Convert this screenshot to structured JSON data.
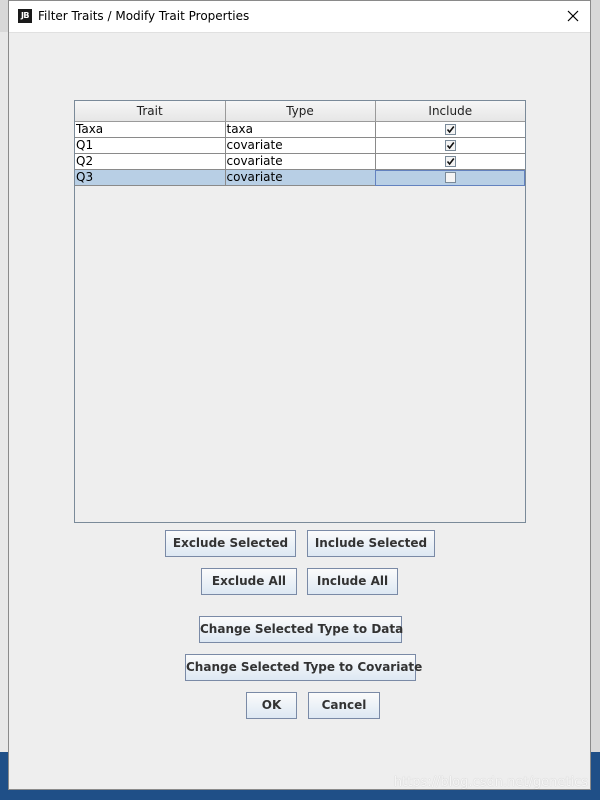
{
  "window": {
    "title": "Filter Traits / Modify Trait Properties",
    "app_icon_text": "JB"
  },
  "table": {
    "columns": [
      "Trait",
      "Type",
      "Include"
    ],
    "rows": [
      {
        "trait": "Taxa",
        "type": "taxa",
        "include": true,
        "selected": false
      },
      {
        "trait": "Q1",
        "type": "covariate",
        "include": true,
        "selected": false
      },
      {
        "trait": "Q2",
        "type": "covariate",
        "include": true,
        "selected": false
      },
      {
        "trait": "Q3",
        "type": "covariate",
        "include": false,
        "selected": true
      }
    ]
  },
  "buttons": {
    "exclude_selected": "Exclude Selected",
    "include_selected": "Include Selected",
    "exclude_all": "Exclude All",
    "include_all": "Include All",
    "change_to_data": "Change Selected Type to Data",
    "change_to_covariate": "Change Selected Type to Covariate",
    "ok": "OK",
    "cancel": "Cancel"
  },
  "watermark": "https://blog.csdn.net/genetics",
  "colors": {
    "selection": "#b8cfe5",
    "dialog_bg": "#eeeeee",
    "desktop": "#1f4f87"
  }
}
